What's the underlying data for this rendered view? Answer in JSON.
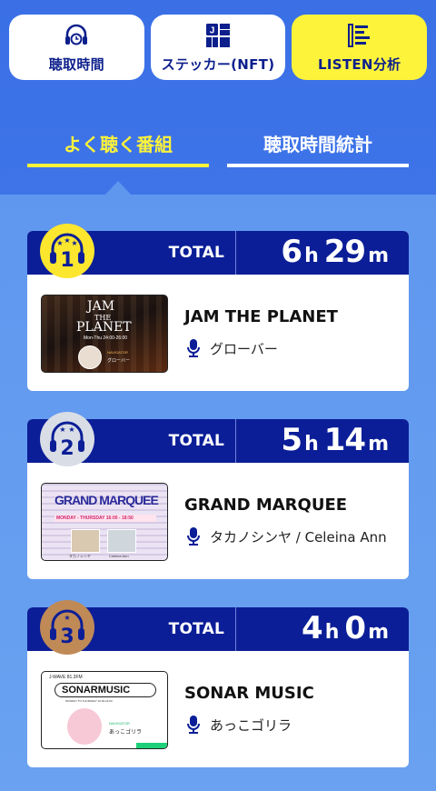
{
  "top_tabs": [
    {
      "label": "聴取時間",
      "icon": "headphones-clock-icon",
      "active": false
    },
    {
      "label": "ステッカー(NFT)",
      "icon": "sticker-grid-icon",
      "active": false
    },
    {
      "label": "LISTEN分析",
      "icon": "list-analysis-icon",
      "active": true
    }
  ],
  "sub_tabs": [
    {
      "label": "よく聴く番組",
      "active": true
    },
    {
      "label": "聴取時間統計",
      "active": false
    }
  ],
  "total_label": "TOTAL",
  "rankings": [
    {
      "rank": "1",
      "badge_color": "#fde62e",
      "hours": "6",
      "hour_unit": "h",
      "minutes": "29",
      "minute_unit": "m",
      "program": "JAM THE PLANET",
      "host": "グローバー",
      "thumb_title_1": "JAM",
      "thumb_title_2": "THE",
      "thumb_title_3": "PLANET",
      "thumb_sub": "Mon-Thu 24:00-26:00",
      "thumb_nav": "NAVIGATOR",
      "thumb_host": "グローバー"
    },
    {
      "rank": "2",
      "badge_color": "#d9dde6",
      "hours": "5",
      "hour_unit": "h",
      "minutes": "14",
      "minute_unit": "m",
      "program": "GRAND MARQUEE",
      "host": "タカノシンヤ / Celeina Ann",
      "thumb_title_1": "GRAND MARQUEE",
      "thumb_sub": "MONDAY - THURSDAY 16:00 - 18:50",
      "thumb_host_a": "タカノシンヤ",
      "thumb_host_b": "Celeina Ann"
    },
    {
      "rank": "3",
      "badge_color": "#c08a57",
      "hours": "4",
      "hour_unit": "h",
      "minutes": "0",
      "minute_unit": "m",
      "program": "SONAR MUSIC",
      "host": "あっこゴリラ",
      "thumb_title_1": "J-WAVE 81.3FM",
      "thumb_title_2": "SONARMUSIC",
      "thumb_sub": "MONDAY TO THURSDAY 22:00-24:00",
      "thumb_nav": "NAVIGATOR",
      "thumb_host": "あっこゴリラ"
    }
  ]
}
